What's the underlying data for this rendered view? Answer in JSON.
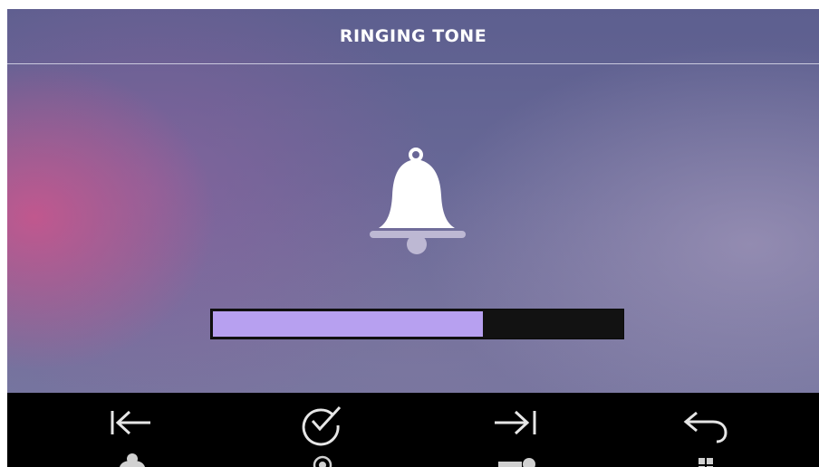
{
  "header": {
    "title": "RINGING TONE"
  },
  "icons": {
    "main": "bell-icon",
    "toolbar": [
      "arrow-left-to-line-icon",
      "check-circle-icon",
      "arrow-right-to-line-icon",
      "return-arrow-icon"
    ],
    "toolbar_secondary": [
      "user-icon",
      "record-dot-icon",
      "key-icon",
      "grid-icon"
    ]
  },
  "volume": {
    "level": 0.66
  },
  "colors": {
    "volume_fill": "#b7a0f0",
    "volume_track": "#121212",
    "toolbar_background": "#000000",
    "title_text": "#ffffff",
    "toolbar_icons": "#e6e6e6"
  }
}
